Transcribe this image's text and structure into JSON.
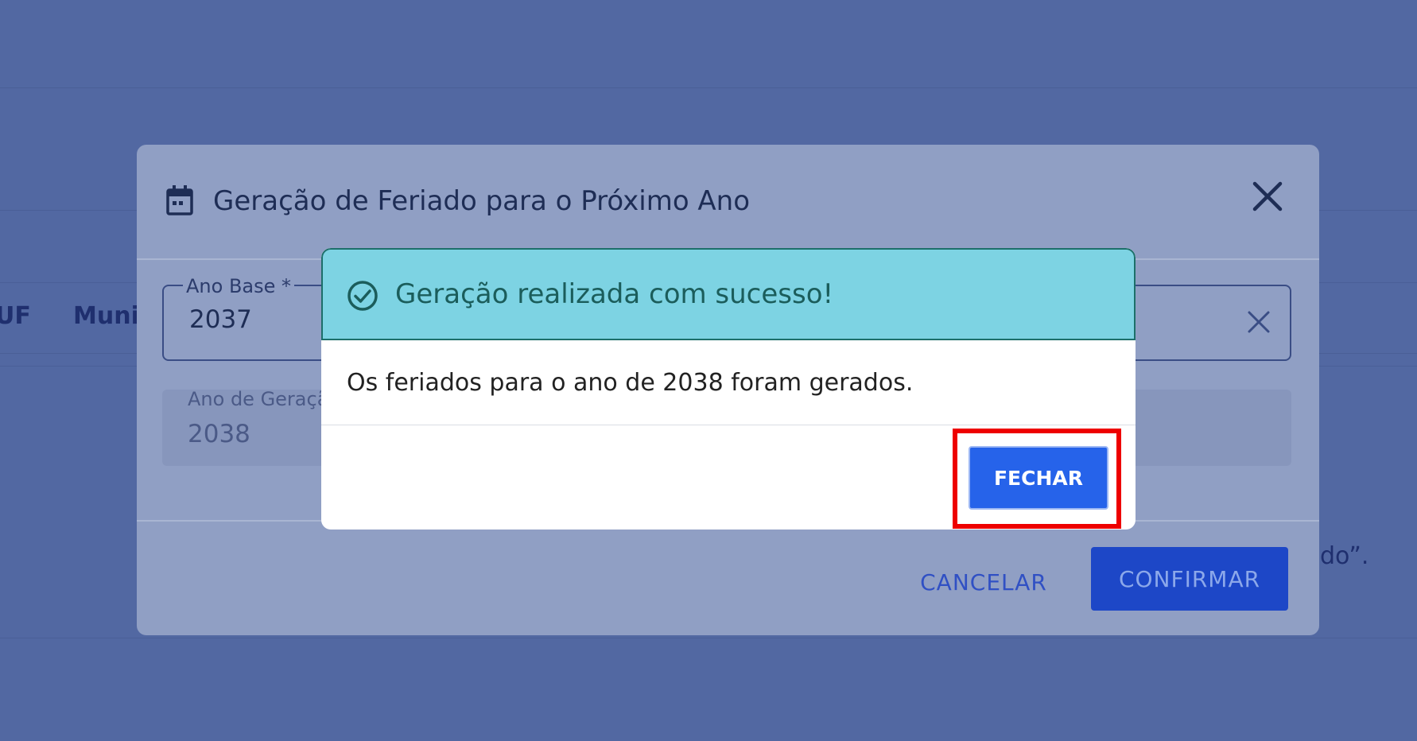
{
  "background": {
    "table_headers": [
      "UF",
      "Muni"
    ],
    "tail_text": "do”."
  },
  "modal": {
    "title": "Geração de Feriado para o Próximo Ano",
    "fields": {
      "ano_base_label": "Ano Base *",
      "ano_base_value": "2037",
      "ano_geracao_label": "Ano de Geração",
      "ano_geracao_value": "2038"
    },
    "cancel_label": "CANCELAR",
    "confirm_label": "CONFIRMAR"
  },
  "dialog": {
    "title": "Geração realizada com sucesso!",
    "message": "Os feriados para o ano de 2038 foram gerados.",
    "close_label": "FECHAR"
  },
  "icons": {
    "calendar": "calendar-icon",
    "close": "close-icon",
    "clear": "clear-icon",
    "success": "check-circle-icon"
  },
  "colors": {
    "overlay": "#5268a2",
    "modal_bg": "#909fc4",
    "success_header": "#7dd3e3",
    "success_text": "#1b5d5b",
    "primary_button": "#2663ea",
    "highlight": "#ee0000"
  }
}
